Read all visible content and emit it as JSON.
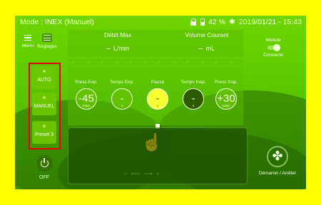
{
  "status_bar": {
    "mode": "Mode : INEX (Manuel)",
    "battery": "42 %",
    "datetime": "2019/01/21 - 15:43",
    "bluetooth_symbol": "✱"
  },
  "metrics": {
    "flow_label": "Débit Max",
    "flow_unit": "L/min",
    "volume_label": "Volume Courant",
    "volume_unit": "mL"
  },
  "nav": {
    "menu_label": "Menu",
    "settings_label": "Réglages"
  },
  "presets": {
    "auto": "AUTO",
    "manual": "MANUEL",
    "preset3": "Preset 3"
  },
  "off_label": "OFF",
  "module": {
    "title": "Module",
    "status": "Connecté"
  },
  "params": [
    {
      "label": "Press Exp.",
      "value": "-45",
      "unit": "mbar"
    },
    {
      "label": "Temps Exp.",
      "value": "-",
      "unit": "s"
    },
    {
      "label": "Pause",
      "value": "-",
      "unit": "s"
    },
    {
      "label": "Temps Insp.",
      "value": "-",
      "unit": "s"
    },
    {
      "label": "Press Insp.",
      "value": "+30",
      "unit": "mbar"
    }
  ],
  "pad": {
    "hint": "− ⟵     ⟶ +",
    "hand_symbol": "☝"
  },
  "start": {
    "label": "Démarrer / Arrêter",
    "icon_symbol": "✤"
  },
  "colors": {
    "frame": "#ffff00",
    "screen_green": "#5ecb00",
    "preset_border": "#e60012",
    "pause_knob": "#f5ff30"
  }
}
